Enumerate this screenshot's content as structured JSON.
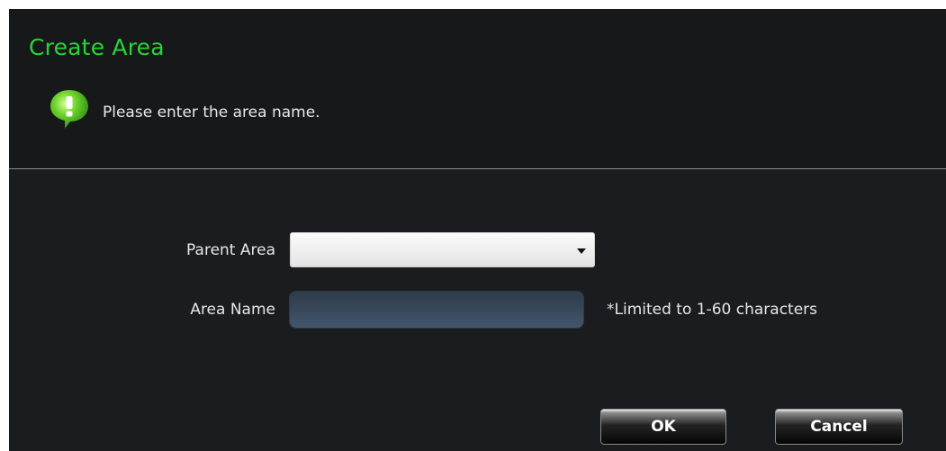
{
  "dialog": {
    "title": "Create Area",
    "hint": "Please enter the area name.",
    "hint_icon": "info-bubble-icon",
    "accent_color": "#28d33a"
  },
  "form": {
    "parent_area_label": "Parent Area",
    "parent_area_value": "",
    "area_name_label": "Area Name",
    "area_name_value": "",
    "area_name_hint": "*Limited to 1-60 characters"
  },
  "buttons": {
    "ok_label": "OK",
    "cancel_label": "Cancel"
  }
}
